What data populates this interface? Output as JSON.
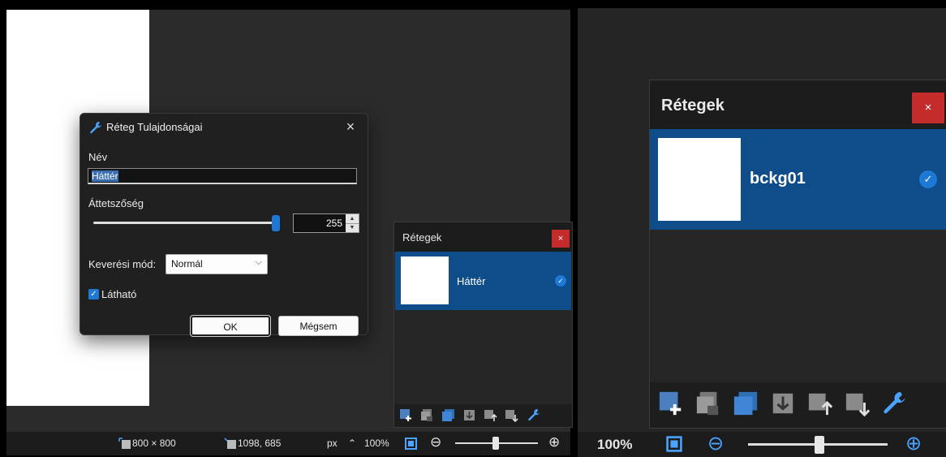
{
  "dialog": {
    "title": "Réteg Tulajdonságai",
    "close_icon": "×",
    "name_label": "Név",
    "name_value": "Háttér",
    "opacity_label": "Áttetszőség",
    "opacity_value": "255",
    "opacity_level": 1.0,
    "spin_up": "▲",
    "spin_down": "▼",
    "blend_label": "Keverési mód:",
    "blend_value": "Normál",
    "blend_chevron": "⌵",
    "visible_label": "Látható",
    "visible_checked": true,
    "check_glyph": "✓",
    "ok_label": "OK",
    "cancel_label": "Mégsem"
  },
  "layers_panel_small": {
    "title": "Rétegek",
    "close_icon": "×",
    "layers": [
      {
        "name": "Háttér",
        "visible": true,
        "selected": true
      }
    ],
    "check_glyph": "✓"
  },
  "layers_panel_large": {
    "title": "Rétegek",
    "close_icon": "×",
    "layers": [
      {
        "name": "bckg01",
        "visible": true,
        "selected": true
      }
    ],
    "check_glyph": "✓"
  },
  "toolbar_icons": [
    "add-layer-icon",
    "delete-layer-icon",
    "duplicate-layer-icon",
    "merge-layer-down-icon",
    "move-layer-up-icon",
    "move-layer-down-icon",
    "layer-properties-icon"
  ],
  "statusbar": {
    "image_size": "800 × 800",
    "cursor_position": "1098, 685",
    "unit": "px",
    "unit_arrow": "⌃",
    "zoom": "100%",
    "zoom_in": "⊕",
    "zoom_out": "⊖",
    "zoom_level": 0.5
  },
  "right_statusbar": {
    "zoom": "100%",
    "zoom_in": "⊕",
    "zoom_out": "⊖"
  },
  "colors": {
    "accent": "#1e78d6",
    "selected_row": "#0f4c8a",
    "close_red": "#c42b2b",
    "panel_bg": "#262626",
    "workspace_bg": "#2b2b2b"
  }
}
